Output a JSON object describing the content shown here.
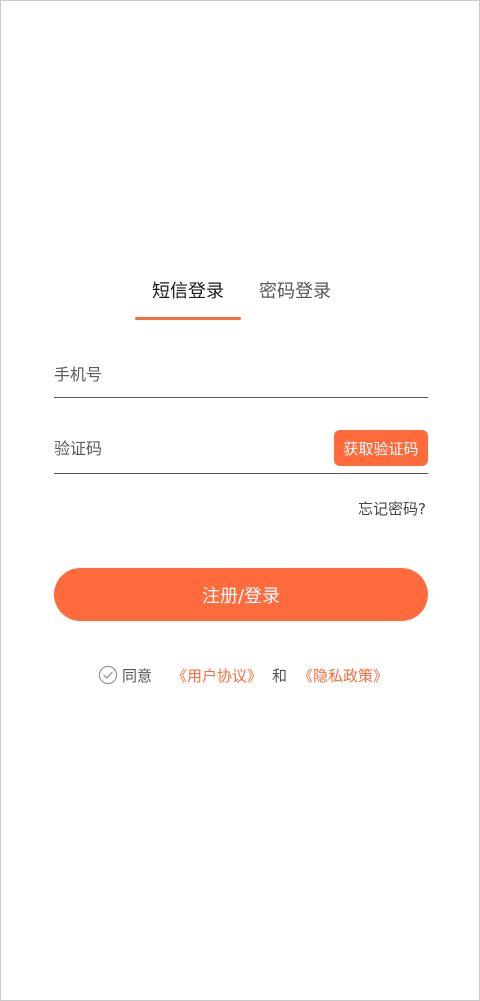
{
  "tabs": {
    "sms_login": "短信登录",
    "password_login": "密码登录",
    "active": "sms_login"
  },
  "form": {
    "phone_placeholder": "手机号",
    "phone_value": "",
    "code_placeholder": "验证码",
    "code_value": "",
    "get_code_label": "获取验证码",
    "forgot_password": "忘记密码?",
    "submit_label": "注册/登录"
  },
  "agreement": {
    "agree_label": "同意",
    "user_agreement": "《用户协议》",
    "and": "和",
    "privacy_policy": "《隐私政策》",
    "checked": false
  },
  "colors": {
    "accent": "#ff6b3d",
    "text_primary": "#1a1a1a",
    "text_secondary": "#555555"
  }
}
